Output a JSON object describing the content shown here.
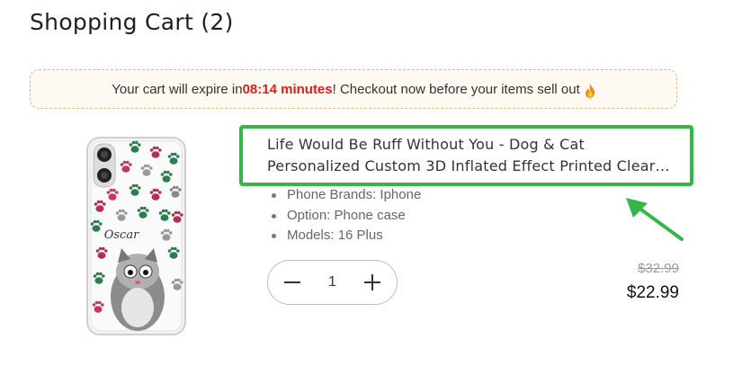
{
  "header": {
    "title": "Shopping Cart (2)"
  },
  "banner": {
    "before": "Your cart will expire in ",
    "time": "08:14 minutes",
    "after": "! Checkout now before your items sell out",
    "icon": "fire-icon"
  },
  "item": {
    "title_line1": "Life Would Be Ruff Without You - Dog & Cat",
    "title_line2": "Personalized Custom 3D Inflated Effect Printed Clear…",
    "image_name": "Oscar",
    "variants": [
      {
        "label": "Phone Brands: Iphone"
      },
      {
        "label": "Option: Phone case"
      },
      {
        "label": "Models: 16 Plus"
      }
    ],
    "quantity": "1",
    "price_original": "$32.99",
    "price_current": "$22.99"
  },
  "colors": {
    "highlight": "#37b44a",
    "urgent": "#d81d1d",
    "banner_bg": "#fffaf1"
  }
}
